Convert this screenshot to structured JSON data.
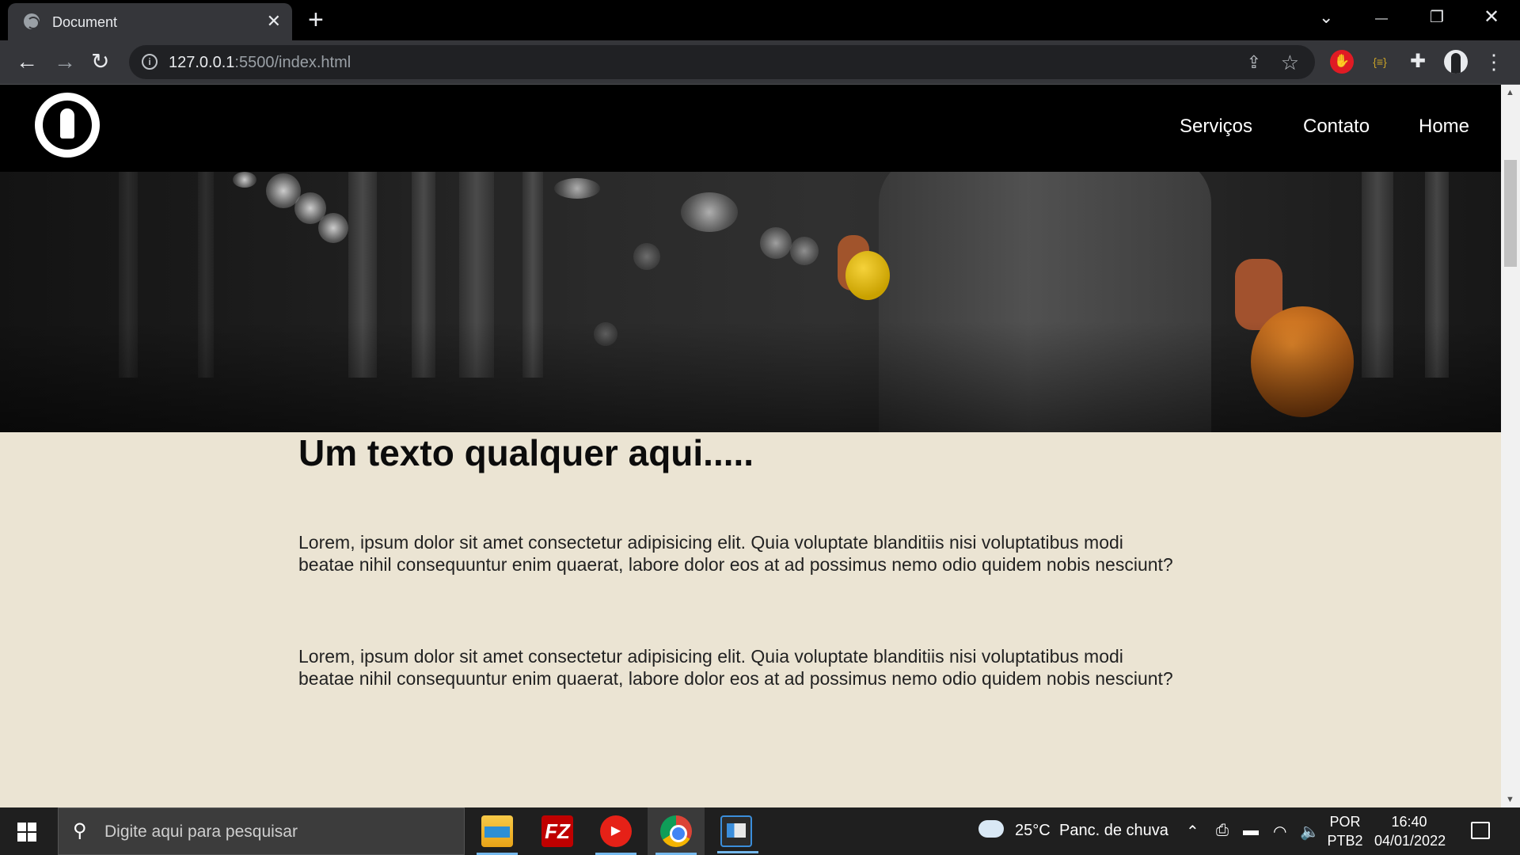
{
  "browser": {
    "tab_title": "Document",
    "tab_close": "✕",
    "new_tab": "+",
    "url_host": "127.0.0.1",
    "url_rest": ":5500/index.html",
    "window_controls": {
      "dropdown": "⌄",
      "minimize": "—",
      "restore": "❐",
      "close": "✕"
    },
    "nav": {
      "back": "←",
      "forward": "→",
      "reload": "↻"
    }
  },
  "site": {
    "nav": [
      "Serviços",
      "Contato",
      "Home"
    ],
    "heading": "Um texto qualquer aqui.....",
    "paragraphs": [
      "Lorem, ipsum dolor sit amet consectetur adipisicing elit. Quia voluptate blanditiis nisi voluptatibus modi beatae nihil consequuntur enim quaerat, labore dolor eos at ad possimus nemo odio quidem nobis nesciunt?",
      "Lorem, ipsum dolor sit amet consectetur adipisicing elit. Quia voluptate blanditiis nisi voluptatibus modi beatae nihil consequuntur enim quaerat, labore dolor eos at ad possimus nemo odio quidem nobis nesciunt?"
    ],
    "colors": {
      "header_bg": "#000000",
      "content_bg": "#ebe4d3"
    }
  },
  "taskbar": {
    "search_placeholder": "Digite aqui para pesquisar",
    "fz_label": "FZ",
    "weather_temp": "25°C",
    "weather_desc": "Panc. de chuva",
    "lang_top": "POR",
    "lang_bottom": "PTB2",
    "time": "16:40",
    "date": "04/01/2022"
  }
}
